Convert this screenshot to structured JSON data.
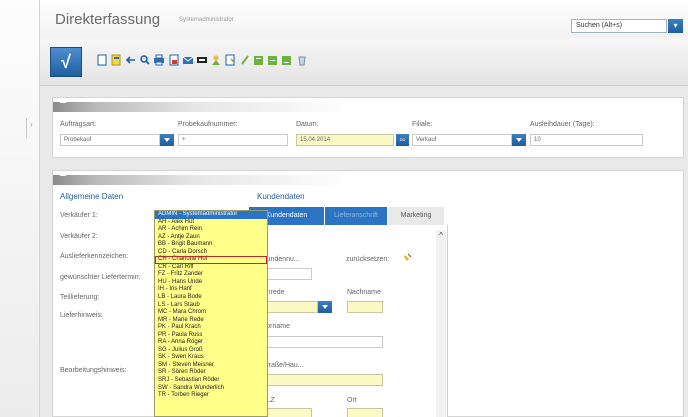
{
  "header": {
    "title": "Direkterfassung",
    "user": "Systemadministrator"
  },
  "search": {
    "value": "Suchen (Alt+s)"
  },
  "toolbar": {
    "icons": [
      "home-icon",
      "new-document-icon",
      "edit-icon",
      "back-icon",
      "search-icon",
      "print-icon",
      "pdf-icon",
      "email-icon",
      "signature-icon",
      "export-icon",
      "refresh-icon",
      "report-icon",
      "report-icon",
      "report-icon",
      "delete-icon"
    ],
    "home_symbol": "√"
  },
  "order": {
    "auftragsart_label": "Auftragsart:",
    "auftragsart_value": "Probekauf",
    "probekaufnummer_label": "Probekaufnummer:",
    "probekaufnummer_value": "+",
    "datum_label": "Datum:",
    "datum_value": "15.04.2014",
    "filiale_label": "Filiale:",
    "filiale_value": "Verkauf",
    "ausleihdauer_label": "Ausleihdauer (Tage):",
    "ausleihdauer_value": "10",
    "calendar_text": "DD"
  },
  "general": {
    "heading": "Allgemeine Daten",
    "verkaeufer1_label": "Verkäufer 1:",
    "verkaeufer2_label": "Verkäufer 2:",
    "auslieferkennzeichen_label": "Auslieferkennzeichen:",
    "liefertermin_label": "gewünschter Liefertermin:",
    "teillieferung_label": "Teillieferung:",
    "lieferhinweis_label": "Lieferhinweis:",
    "bearbeitungshinweis_label": "Bearbeitungshinweis:"
  },
  "customer": {
    "heading": "Kundendaten",
    "tabs": [
      "Kundendaten",
      "Lieferanschrift",
      "Marketing"
    ],
    "kundennummer_label": "Kundennu...",
    "zuruecksetzen_label": "zurücksetzen:",
    "anrede_label": "Anrede",
    "nachname_label": "Nachname",
    "vorname_label": "Vorname",
    "strasse_label": "Straße/Hau...",
    "plz_label": "PLZ",
    "ort_label": "Ort"
  },
  "dropdown": {
    "items": [
      "ADMIN - Systemadministrator",
      "AH - Alex Hut",
      "AR - Achim Rein",
      "AZ - Antje Zaun",
      "BB - Brigit Baumann",
      "CD - Carla Dorsch",
      "CH - Charlotte Hof",
      "CR - Carl Riff",
      "FZ - Fritz Zander",
      "HU - Hans Unde",
      "IH - Iris Hanf",
      "LB - Laura Bode",
      "LS - Lars Staub",
      "MC - Mara Chrom",
      "MR - Marie Rede",
      "PK - Paul Krach",
      "PR - Paula Russ",
      "RA - Anna Röger",
      "SG - Julius Groß",
      "SK - Swen Kraus",
      "SM - Steven Meisner",
      "SR - Sören Röder",
      "SRJ - Sebastian Röder",
      "SW - Sandra Wunderlich",
      "TR - Torben Rieger"
    ]
  },
  "colors": {
    "accent": "#1f5e9e",
    "required_field": "#fcfac4",
    "dropdown_bg": "#ffff8a",
    "highlight": "#c0282b"
  }
}
